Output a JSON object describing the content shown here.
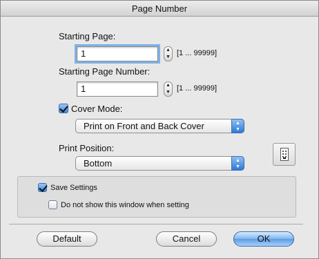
{
  "window": {
    "title": "Page Number"
  },
  "starting_page": {
    "label": "Starting Page:",
    "value": "1",
    "range": "[1 ... 99999]"
  },
  "starting_page_number": {
    "label": "Starting Page Number:",
    "value": "1",
    "range": "[1 ... 99999]"
  },
  "cover_mode": {
    "label": "Cover Mode:",
    "checked": true,
    "selected": "Print on Front and Back Cover"
  },
  "print_position": {
    "label": "Print Position:",
    "selected": "Bottom",
    "preview_icon": "page-number-position-icon"
  },
  "settings": {
    "save_settings_label": "Save Settings",
    "save_settings_checked": true,
    "do_not_show_label": "Do not show this window when setting",
    "do_not_show_checked": false
  },
  "buttons": {
    "default_label": "Default",
    "cancel_label": "Cancel",
    "ok_label": "OK"
  },
  "colors": {
    "accent": "#3f86db",
    "window_bg": "#e8e8e8"
  }
}
